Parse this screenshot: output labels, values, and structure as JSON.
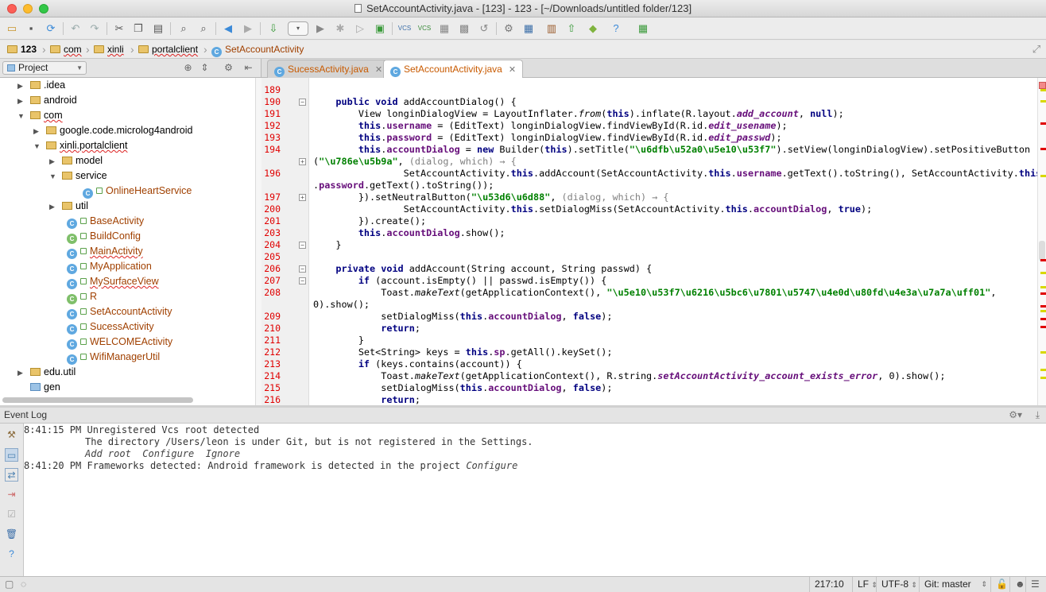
{
  "window": {
    "title": "SetAccountActivity.java - [123] - 123 - [~/Downloads/untitled folder/123]"
  },
  "colors": {
    "keyword": "#000080",
    "string": "#008000",
    "field": "#660e7a",
    "line_number": "#e00000",
    "tab_text": "#c85a00"
  },
  "breadcrumbs": [
    "123",
    "com",
    "xinli",
    "portalclient",
    "SetAccountActivity"
  ],
  "project_panel": {
    "selector": "Project"
  },
  "editor_tabs": [
    {
      "label": "SucessActivity.java",
      "active": false
    },
    {
      "label": "SetAccountActivity.java",
      "active": true
    }
  ],
  "tree": [
    {
      "label": ".idea",
      "depth": 1,
      "arrow": "▶",
      "icon": "folder"
    },
    {
      "label": "android",
      "depth": 1,
      "arrow": "▶",
      "icon": "folder"
    },
    {
      "label": "com",
      "depth": 1,
      "arrow": "▼",
      "icon": "folder"
    },
    {
      "label": "google.code.microlog4android",
      "depth": 2,
      "arrow": "▶",
      "icon": "folder"
    },
    {
      "label": "xinli.portalclient",
      "depth": 2,
      "arrow": "▼",
      "icon": "folder"
    },
    {
      "label": "model",
      "depth": 3,
      "arrow": "▶",
      "icon": "folder"
    },
    {
      "label": "service",
      "depth": 3,
      "arrow": "▼",
      "icon": "folder"
    },
    {
      "label": "OnlineHeartService",
      "depth": 4,
      "arrow": "",
      "icon": "class"
    },
    {
      "label": "util",
      "depth": 3,
      "arrow": "▶",
      "icon": "folder"
    },
    {
      "label": "BaseActivity",
      "depth": 3,
      "arrow": "",
      "icon": "class"
    },
    {
      "label": "BuildConfig",
      "depth": 3,
      "arrow": "",
      "icon": "class"
    },
    {
      "label": "MainActivity",
      "depth": 3,
      "arrow": "",
      "icon": "class"
    },
    {
      "label": "MyApplication",
      "depth": 3,
      "arrow": "",
      "icon": "class"
    },
    {
      "label": "MySurfaceView",
      "depth": 3,
      "arrow": "",
      "icon": "class"
    },
    {
      "label": "R",
      "depth": 3,
      "arrow": "",
      "icon": "class"
    },
    {
      "label": "SetAccountActivity",
      "depth": 3,
      "arrow": "",
      "icon": "class"
    },
    {
      "label": "SucessActivity",
      "depth": 3,
      "arrow": "",
      "icon": "class"
    },
    {
      "label": "WELCOMEActivity",
      "depth": 3,
      "arrow": "",
      "icon": "class"
    },
    {
      "label": "WifiManagerUtil",
      "depth": 3,
      "arrow": "",
      "icon": "class"
    },
    {
      "label": "edu.util",
      "depth": 1,
      "arrow": "▶",
      "icon": "folder"
    },
    {
      "label": "gen",
      "depth": 1,
      "arrow": "",
      "icon": "folder"
    }
  ],
  "code": [
    {
      "ln": "189",
      "text": ""
    },
    {
      "ln": "190",
      "text": "    public void addAccountDialog() {"
    },
    {
      "ln": "191",
      "text": "        View longinDialogView = LayoutInflater.from(this).inflate(R.layout.add_account, null);"
    },
    {
      "ln": "192",
      "text": "        this.username = (EditText) longinDialogView.findViewById(R.id.edit_usename);"
    },
    {
      "ln": "193",
      "text": "        this.password = (EditText) longinDialogView.findViewById(R.id.edit_passwd);"
    },
    {
      "ln": "194",
      "text": "        this.accountDialog = new Builder(this).setTitle(\"\\u6dfb\\u52a0\\u5e10\\u53f7\").setView(longinDialogView).setPositiveButton"
    },
    {
      "ln": "",
      "text": "(\"\\u786e\\u5b9a\", (dialog, which) → {"
    },
    {
      "ln": "196",
      "text": "                SetAccountActivity.this.addAccount(SetAccountActivity.this.username.getText().toString(), SetAccountActivity.this"
    },
    {
      "ln": "",
      "text": ".password.getText().toString());"
    },
    {
      "ln": "197",
      "text": "        }).setNeutralButton(\"\\u53d6\\u6d88\", (dialog, which) → {"
    },
    {
      "ln": "200",
      "text": "                SetAccountActivity.this.setDialogMiss(SetAccountActivity.this.accountDialog, true);"
    },
    {
      "ln": "201",
      "text": "        }).create();"
    },
    {
      "ln": "203",
      "text": "        this.accountDialog.show();"
    },
    {
      "ln": "204",
      "text": "    }"
    },
    {
      "ln": "205",
      "text": ""
    },
    {
      "ln": "206",
      "text": "    private void addAccount(String account, String passwd) {"
    },
    {
      "ln": "207",
      "text": "        if (account.isEmpty() || passwd.isEmpty()) {"
    },
    {
      "ln": "208",
      "text": "            Toast.makeText(getApplicationContext(), \"\\u5e10\\u53f7\\u6216\\u5bc6\\u7801\\u5747\\u4e0d\\u80fd\\u4e3a\\u7a7a\\uff01\","
    },
    {
      "ln": "",
      "text": "0).show();"
    },
    {
      "ln": "209",
      "text": "            setDialogMiss(this.accountDialog, false);"
    },
    {
      "ln": "210",
      "text": "            return;"
    },
    {
      "ln": "211",
      "text": "        }"
    },
    {
      "ln": "212",
      "text": "        Set<String> keys = this.sp.getAll().keySet();"
    },
    {
      "ln": "213",
      "text": "        if (keys.contains(account)) {"
    },
    {
      "ln": "214",
      "text": "            Toast.makeText(getApplicationContext(), R.string.setAccountActivity_account_exists_error, 0).show();"
    },
    {
      "ln": "215",
      "text": "            setDialogMiss(this.accountDialog, false);"
    },
    {
      "ln": "216",
      "text": "            return;"
    }
  ],
  "event_log": {
    "title": "Event Log",
    "entries": [
      {
        "time": "8:41:15 PM",
        "text": "Unregistered Vcs root detected"
      },
      {
        "time": "",
        "text": "The directory /Users/leon is under Git, but is not registered in the Settings."
      },
      {
        "time": "",
        "links": [
          "Add root",
          "Configure",
          "Ignore"
        ]
      },
      {
        "time": "8:41:20 PM",
        "text": "Frameworks detected: Android framework is detected in the project",
        "link": "Configure"
      }
    ]
  },
  "status": {
    "position": "217:10",
    "line_sep": "LF",
    "encoding": "UTF-8",
    "vcs": "Git: master"
  }
}
